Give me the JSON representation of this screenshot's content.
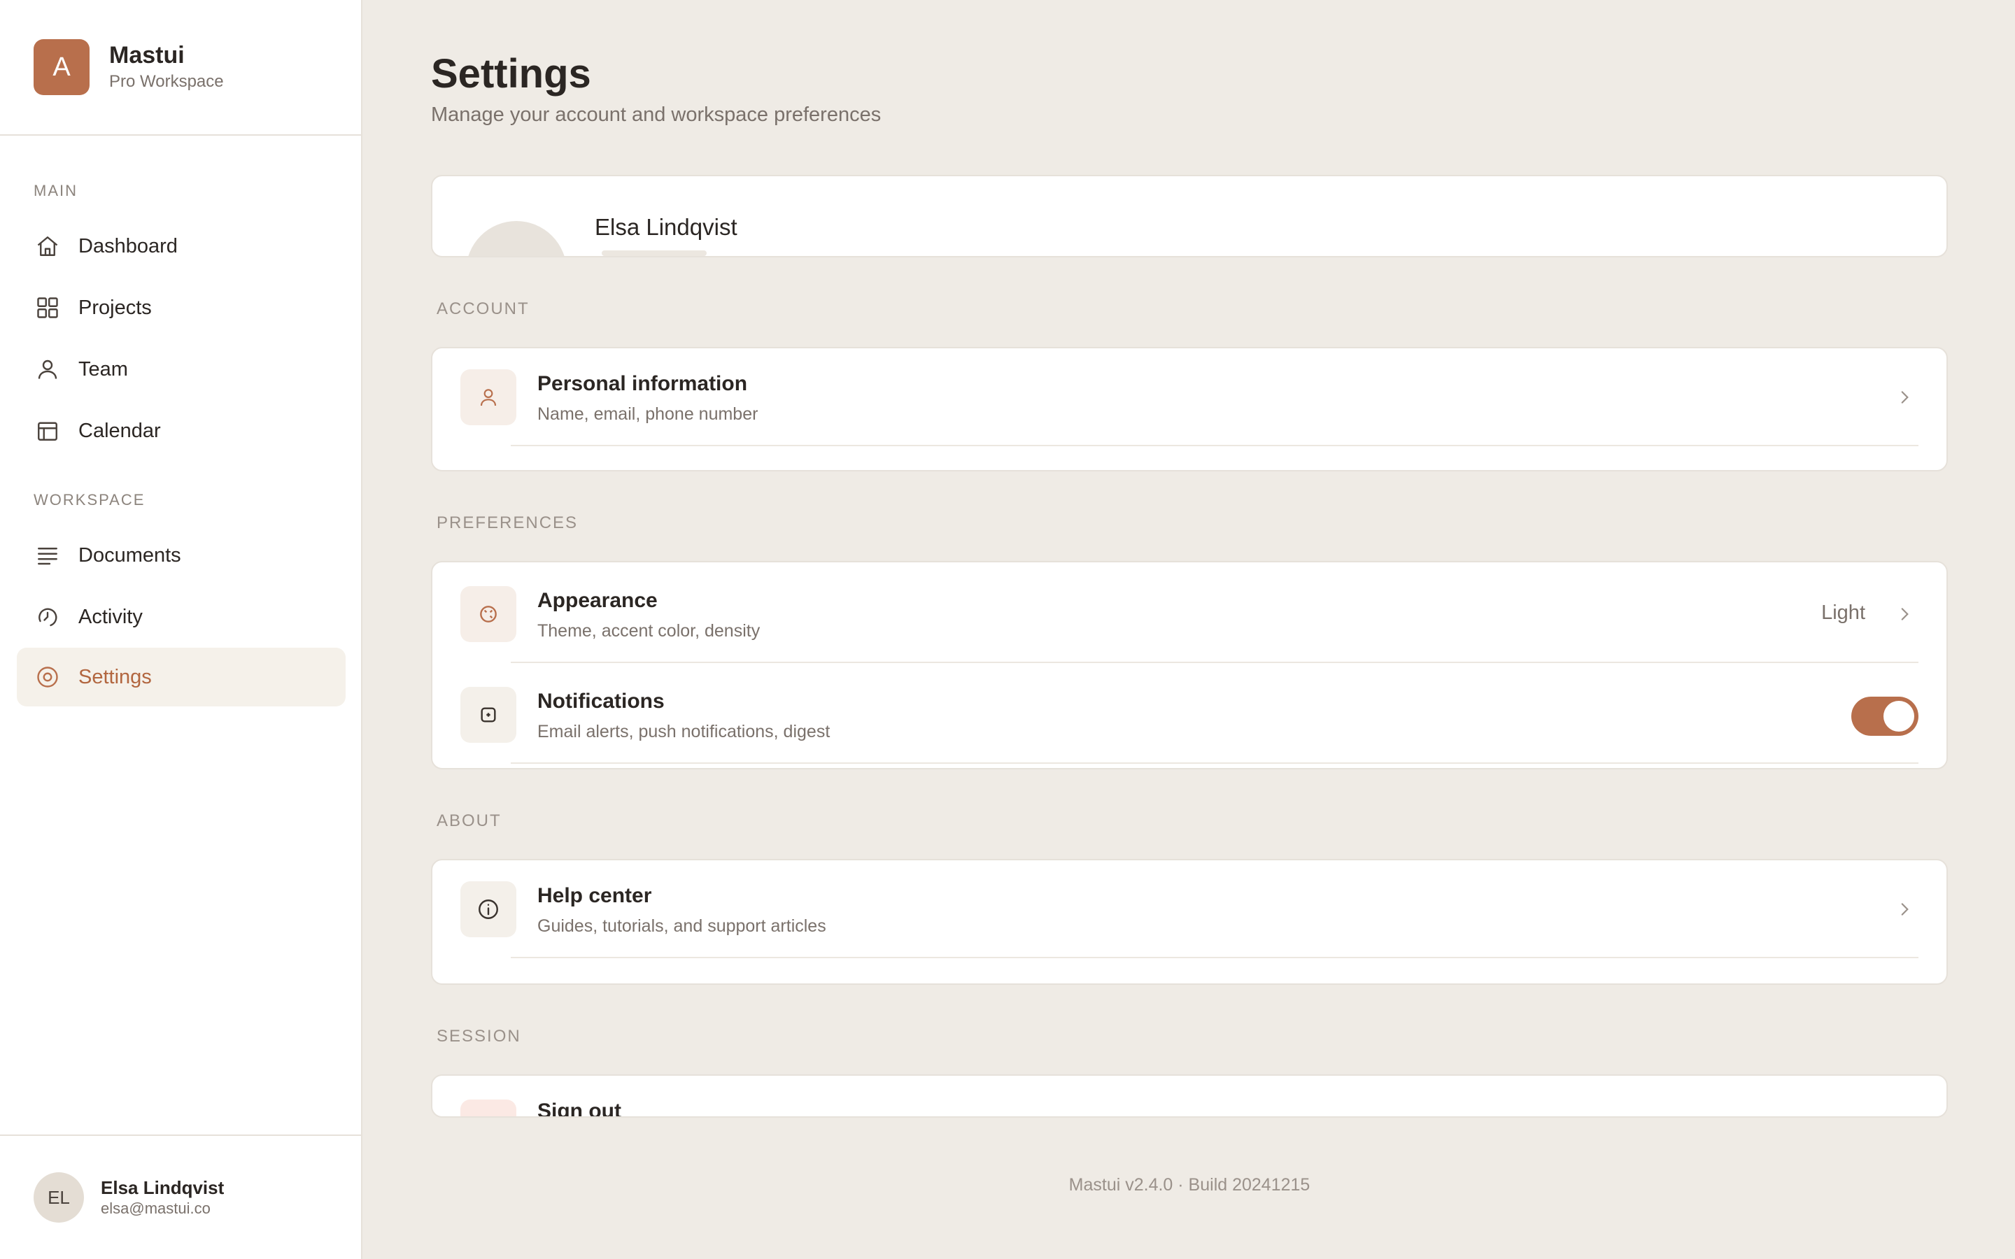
{
  "sidebar": {
    "brand": {
      "logo_letter": "A",
      "name": "Mastui",
      "subtitle": "Pro Workspace"
    },
    "sections": [
      {
        "label": "MAIN"
      },
      {
        "label": "WORKSPACE"
      }
    ],
    "items": [
      {
        "label": "Dashboard",
        "icon": "home-icon"
      },
      {
        "label": "Projects",
        "icon": "grid-icon"
      },
      {
        "label": "Team",
        "icon": "user-icon"
      },
      {
        "label": "Calendar",
        "icon": "calendar-icon"
      },
      {
        "label": "Documents",
        "icon": "lines-icon"
      },
      {
        "label": "Activity",
        "icon": "activity-icon"
      },
      {
        "label": "Settings",
        "icon": "settings-icon",
        "active": true
      }
    ],
    "user": {
      "initials": "EL",
      "name": "Elsa Lindqvist",
      "email": "elsa@mastui.co"
    }
  },
  "main": {
    "title": "Settings",
    "subtitle": "Manage your account and workspace preferences",
    "profile": {
      "name": "Elsa Lindqvist"
    },
    "groups": {
      "account": "ACCOUNT",
      "preferences": "PREFERENCES",
      "about": "ABOUT",
      "session": "SESSION"
    },
    "rows": {
      "personal": {
        "title": "Personal information",
        "desc": "Name, email, phone number"
      },
      "appearance": {
        "title": "Appearance",
        "desc": "Theme, accent color, density",
        "value": "Light"
      },
      "notifications": {
        "title": "Notifications",
        "desc": "Email alerts, push notifications, digest",
        "enabled": true
      },
      "help": {
        "title": "Help center",
        "desc": "Guides, tutorials, and support articles"
      },
      "signout": {
        "title": "Sign out"
      }
    },
    "footer": "Mastui v2.4.0 · Build 20241215"
  },
  "colors": {
    "accent": "#b86f4c",
    "background": "#efebe5",
    "surface": "#ffffff"
  }
}
